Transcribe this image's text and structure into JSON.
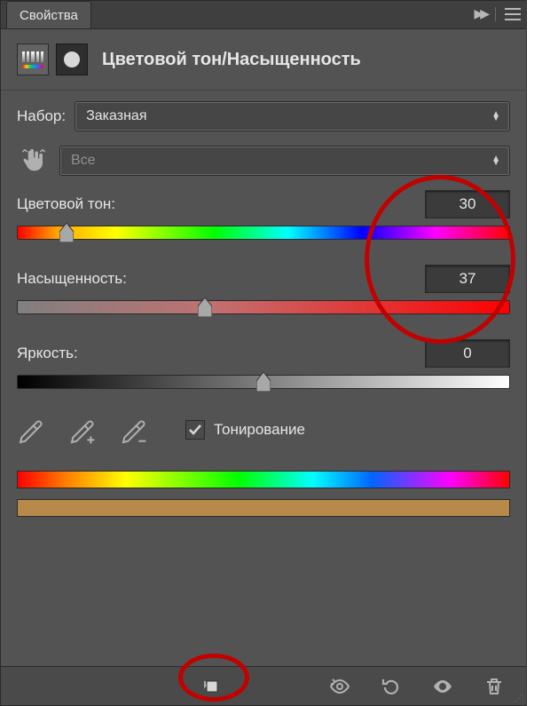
{
  "tab": {
    "title": "Свойства"
  },
  "header": {
    "title": "Цветовой тон/Насыщенность"
  },
  "preset": {
    "label": "Набор:",
    "value": "Заказная"
  },
  "channel": {
    "value": "Все"
  },
  "hue": {
    "label": "Цветовой тон:",
    "value": "30",
    "pos_pct": 10
  },
  "saturation": {
    "label": "Насыщенность:",
    "value": "37",
    "pos_pct": 38
  },
  "lightness": {
    "label": "Яркость:",
    "value": "0",
    "pos_pct": 50
  },
  "colorize": {
    "label": "Тонирование",
    "checked": true
  }
}
